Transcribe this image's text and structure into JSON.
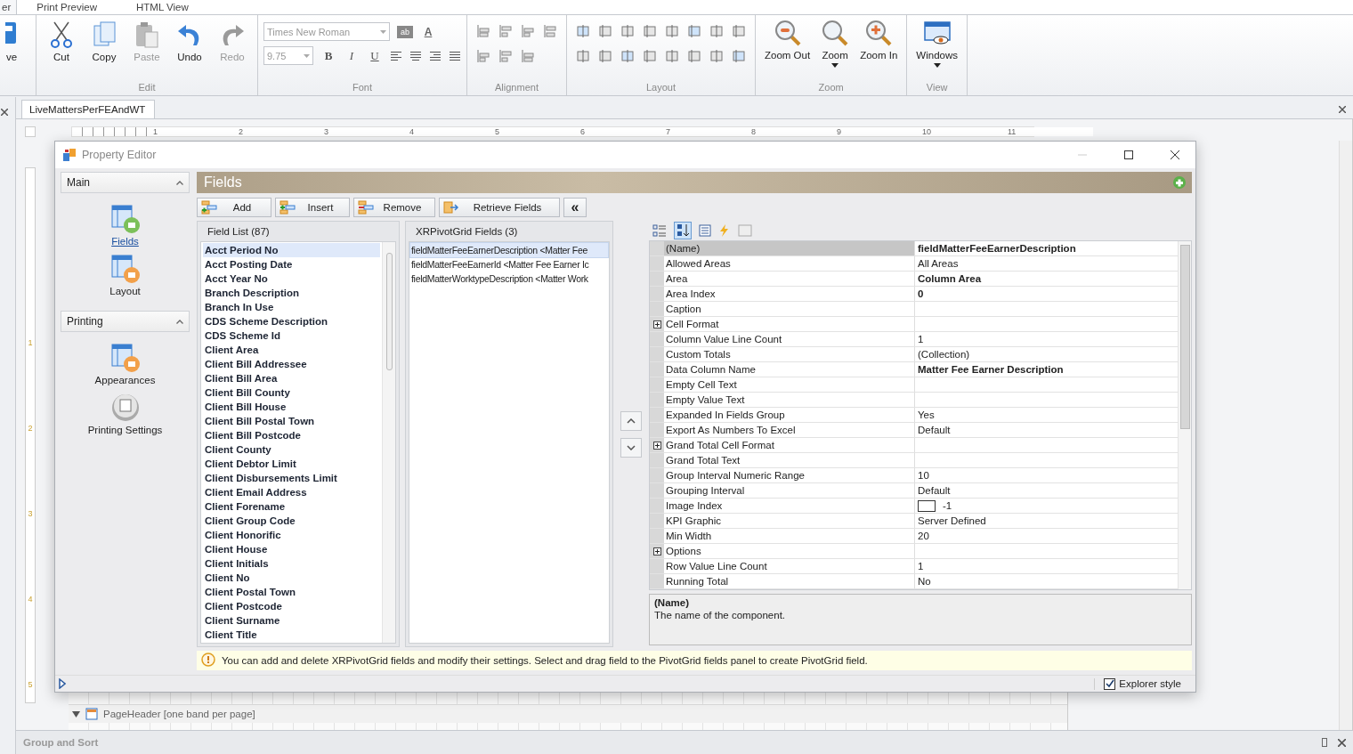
{
  "ribbon": {
    "tabs": [
      {
        "label": "er",
        "selected": true
      },
      {
        "label": "Print Preview",
        "selected": false
      },
      {
        "label": "HTML View",
        "selected": false
      }
    ],
    "cut_button": "ve",
    "edit_group": {
      "title": "Edit",
      "buttons": [
        {
          "label": "Cut",
          "kind": "cut",
          "disabled": false
        },
        {
          "label": "Copy",
          "kind": "copy",
          "disabled": false
        },
        {
          "label": "Paste",
          "kind": "paste",
          "disabled": true
        },
        {
          "label": "Undo",
          "kind": "undo",
          "disabled": false
        },
        {
          "label": "Redo",
          "kind": "redo",
          "disabled": true
        }
      ]
    },
    "font_group": {
      "title": "Font",
      "font_name": "Times New Roman",
      "font_size": "9.75",
      "highlight_glyph": "ab",
      "color_glyph": "A",
      "styles": [
        {
          "label": "B",
          "kind": "bold"
        },
        {
          "label": "I",
          "kind": "italic"
        },
        {
          "label": "U",
          "kind": "underline"
        }
      ]
    },
    "alignment_group": {
      "title": "Alignment"
    },
    "layout_group": {
      "title": "Layout"
    },
    "zoom_group": {
      "title": "Zoom",
      "buttons": [
        {
          "label": "Zoom Out",
          "kind": "zoom-out",
          "dropdown": false
        },
        {
          "label": "Zoom",
          "kind": "zoom",
          "dropdown": true
        },
        {
          "label": "Zoom In",
          "kind": "zoom-in",
          "dropdown": false
        }
      ]
    },
    "view_group": {
      "title": "View",
      "button": {
        "label": "Windows",
        "dropdown": true
      }
    }
  },
  "document_tab": "LiveMattersPerFEAndWT",
  "top_ruler": [
    "1",
    "2",
    "3",
    "4",
    "5",
    "6",
    "7",
    "8",
    "9",
    "10",
    "11"
  ],
  "left_ruler": [
    "1",
    "2",
    "3",
    "4",
    "5"
  ],
  "dialog": {
    "title": "Property Editor",
    "nav_groups": [
      {
        "title": "Main",
        "expanded": true,
        "items": [
          {
            "label": "Fields",
            "kind": "fields",
            "selected": true
          },
          {
            "label": "Layout",
            "kind": "layout",
            "selected": false
          }
        ]
      },
      {
        "title": "Printing",
        "expanded": true,
        "items": [
          {
            "label": "Appearances",
            "kind": "appearances",
            "selected": false
          },
          {
            "label": "Printing Settings",
            "kind": "printing",
            "selected": false
          }
        ]
      }
    ],
    "header": "Fields",
    "toolbar": [
      {
        "label": "Add",
        "kind": "add"
      },
      {
        "label": "Insert",
        "kind": "insert"
      },
      {
        "label": "Remove",
        "kind": "remove"
      },
      {
        "label": "Retrieve Fields",
        "kind": "retrieve"
      }
    ],
    "collapse_glyph": "«",
    "field_list": {
      "title": "Field List (87)",
      "items": [
        {
          "label": "Acct Period No",
          "selected": true
        },
        {
          "label": "Acct Posting Date",
          "selected": false
        },
        {
          "label": "Acct Year No",
          "selected": false
        },
        {
          "label": "Branch Description",
          "selected": false
        },
        {
          "label": "Branch In Use",
          "selected": false
        },
        {
          "label": "CDS Scheme Description",
          "selected": false
        },
        {
          "label": "CDS Scheme Id",
          "selected": false
        },
        {
          "label": "Client Area",
          "selected": false
        },
        {
          "label": "Client Bill Addressee",
          "selected": false
        },
        {
          "label": "Client Bill Area",
          "selected": false
        },
        {
          "label": "Client Bill County",
          "selected": false
        },
        {
          "label": "Client Bill House",
          "selected": false
        },
        {
          "label": "Client Bill Postal Town",
          "selected": false
        },
        {
          "label": "Client Bill Postcode",
          "selected": false
        },
        {
          "label": "Client County",
          "selected": false
        },
        {
          "label": "Client Debtor Limit",
          "selected": false
        },
        {
          "label": "Client Disbursements Limit",
          "selected": false
        },
        {
          "label": "Client Email Address",
          "selected": false
        },
        {
          "label": "Client Forename",
          "selected": false
        },
        {
          "label": "Client Group Code",
          "selected": false
        },
        {
          "label": "Client Honorific",
          "selected": false
        },
        {
          "label": "Client House",
          "selected": false
        },
        {
          "label": "Client Initials",
          "selected": false
        },
        {
          "label": "Client No",
          "selected": false
        },
        {
          "label": "Client Postal Town",
          "selected": false
        },
        {
          "label": "Client Postcode",
          "selected": false
        },
        {
          "label": "Client Surname",
          "selected": false
        },
        {
          "label": "Client Title",
          "selected": false
        }
      ]
    },
    "pivot_fields": {
      "title": "XRPivotGrid Fields (3)",
      "items": [
        {
          "label": "fieldMatterFeeEarnerDescription <Matter Fee",
          "selected": true
        },
        {
          "label": "fieldMatterFeeEarnerId <Matter Fee Earner Ic",
          "selected": false
        },
        {
          "label": "fieldMatterWorktypeDescription <Matter Work",
          "selected": false
        }
      ]
    },
    "properties": {
      "rows": [
        {
          "name": "(Name)",
          "value": "fieldMatterFeeEarnerDescription",
          "kind": "text",
          "bold": true,
          "expandable": false,
          "selected": true
        },
        {
          "name": "Allowed Areas",
          "value": "All Areas",
          "kind": "text",
          "bold": false,
          "expandable": false,
          "selected": false
        },
        {
          "name": "Area",
          "value": "Column Area",
          "kind": "text",
          "bold": true,
          "expandable": false,
          "selected": false
        },
        {
          "name": "Area Index",
          "value": "0",
          "kind": "text",
          "bold": true,
          "expandable": false,
          "selected": false
        },
        {
          "name": "Caption",
          "expandable": false,
          "selected": false
        },
        {
          "name": "Cell Format",
          "expandable": true,
          "selected": false
        },
        {
          "name": "Column Value Line Count",
          "value": "1",
          "kind": "text",
          "bold": false,
          "expandable": false,
          "selected": false
        },
        {
          "name": "Custom Totals",
          "value": "(Collection)",
          "kind": "text",
          "bold": false,
          "expandable": false,
          "selected": false
        },
        {
          "name": "Data Column Name",
          "value": "Matter Fee Earner Description",
          "kind": "text",
          "bold": true,
          "expandable": false,
          "selected": false
        },
        {
          "name": "Empty Cell Text",
          "expandable": false,
          "selected": false
        },
        {
          "name": "Empty Value Text",
          "expandable": false,
          "selected": false
        },
        {
          "name": "Expanded In Fields Group",
          "value": "Yes",
          "kind": "text",
          "bold": false,
          "expandable": false,
          "selected": false
        },
        {
          "name": "Export As Numbers To Excel",
          "value": "Default",
          "kind": "text",
          "bold": false,
          "expandable": false,
          "selected": false
        },
        {
          "name": "Grand Total Cell Format",
          "expandable": true,
          "selected": false
        },
        {
          "name": "Grand Total Text",
          "expandable": false,
          "selected": false
        },
        {
          "name": "Group Interval Numeric Range",
          "value": "10",
          "kind": "text",
          "bold": false,
          "expandable": false,
          "selected": false
        },
        {
          "name": "Grouping Interval",
          "value": "Default",
          "kind": "text",
          "bold": false,
          "expandable": false,
          "selected": false
        },
        {
          "name": "Image Index",
          "value": "-1",
          "kind": "image",
          "bold": false,
          "expandable": false,
          "selected": false
        },
        {
          "name": "KPI Graphic",
          "value": "Server Defined",
          "kind": "text",
          "bold": false,
          "expandable": false,
          "selected": false
        },
        {
          "name": "Min Width",
          "value": "20",
          "kind": "text",
          "bold": false,
          "expandable": false,
          "selected": false
        },
        {
          "name": "Options",
          "expandable": true,
          "selected": false
        },
        {
          "name": "Row Value Line Count",
          "value": "1",
          "kind": "text",
          "bold": false,
          "expandable": false,
          "selected": false
        },
        {
          "name": "Running Total",
          "value": "No",
          "kind": "text",
          "bold": false,
          "expandable": false,
          "selected": false
        }
      ],
      "description_title": "(Name)",
      "description": "The name of the component."
    },
    "hint": "You can add and delete XRPivotGrid fields and modify their settings. Select and drag field to the PivotGrid fields panel to create PivotGrid field.",
    "explorer_style": {
      "label": "Explorer style",
      "checked": true
    }
  },
  "band": {
    "label": "PageHeader [one band per page]",
    "expanded": true
  },
  "bottom_panel": {
    "title": "Group and Sort"
  }
}
